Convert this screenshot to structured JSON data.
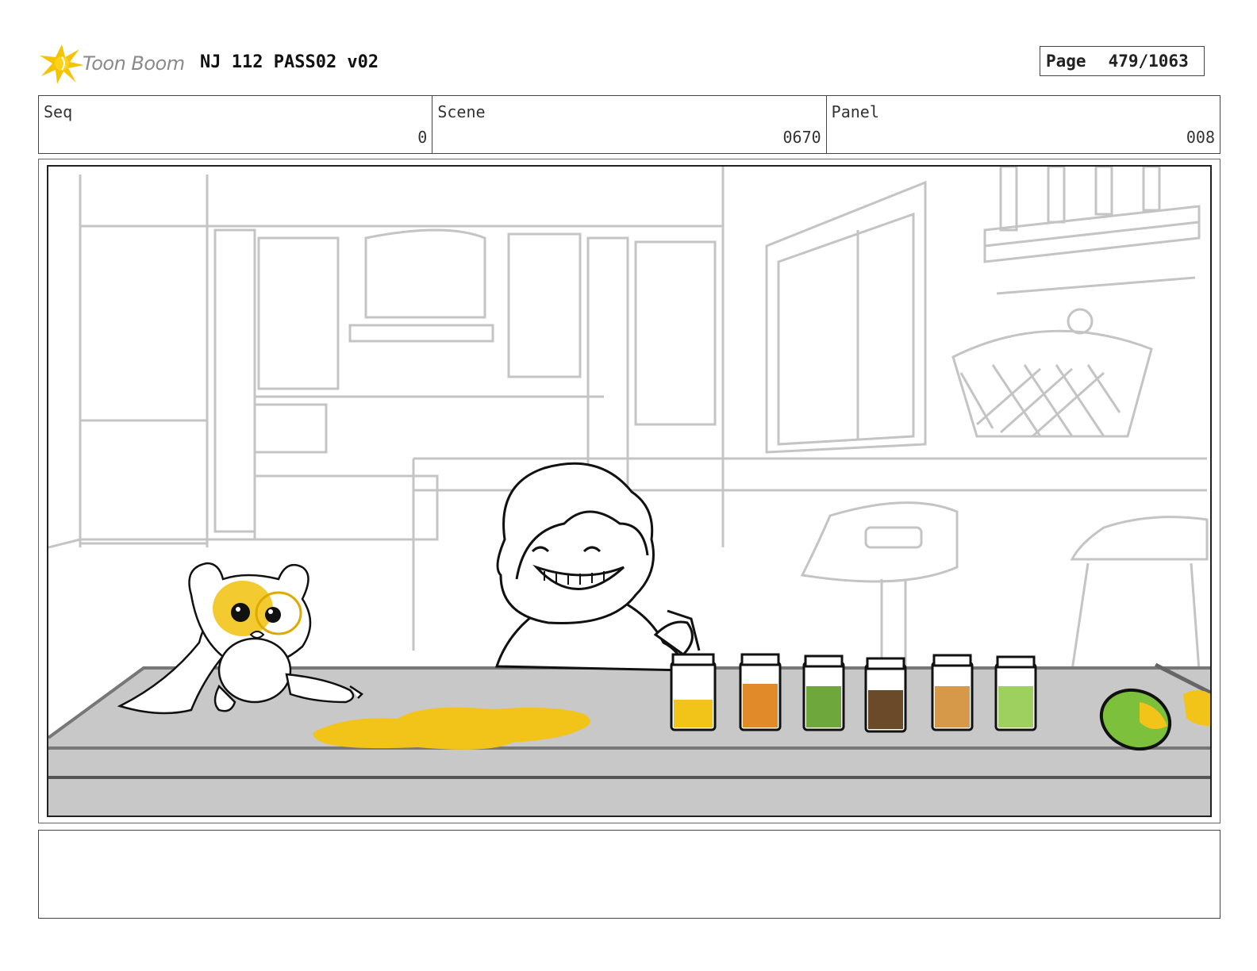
{
  "header": {
    "logo_text": "Toon Boom",
    "title": "NJ 112 PASS02 v02",
    "page_label": "Page",
    "page_number": "479/1063"
  },
  "fields": {
    "seq": {
      "label": "Seq",
      "value": "0"
    },
    "scene": {
      "label": "Scene",
      "value": "0670"
    },
    "panel": {
      "label": "Panel",
      "value": "008"
    }
  },
  "notes": {
    "text": ""
  },
  "colors": {
    "logo_yellow": "#f5c400",
    "counter_gray": "#c8c8c8",
    "spill_yellow": "#f2c41a",
    "jar_fills": [
      "#f2c41a",
      "#e08a2a",
      "#6ea83c",
      "#6b4a2a",
      "#d6994a",
      "#9ed060"
    ],
    "fruit_green": "#7cc03c"
  }
}
